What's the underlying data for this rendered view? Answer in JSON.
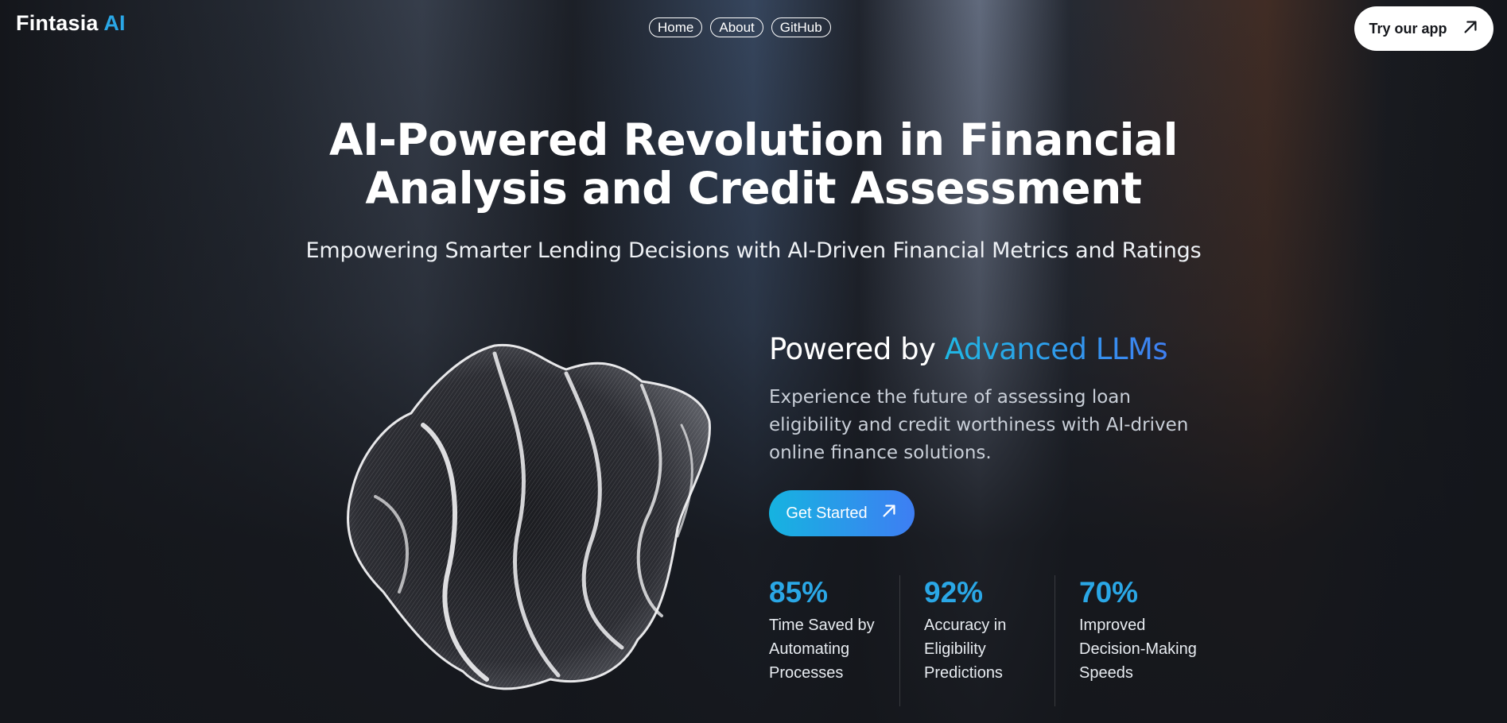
{
  "brand": {
    "name": "Fintasia",
    "accent": "AI",
    "accent_color": "#2aa7e6"
  },
  "nav": {
    "items": [
      {
        "label": "Home"
      },
      {
        "label": "About"
      },
      {
        "label": "GitHub"
      }
    ]
  },
  "header": {
    "cta_label": "Try our app",
    "cta_icon": "arrow-up-right-icon"
  },
  "hero": {
    "title_line1": "AI-Powered Revolution in Financial",
    "title_line2": "Analysis and Credit Assessment",
    "subtitle": "Empowering Smarter Lending Decisions with AI-Driven Financial Metrics and Ratings"
  },
  "feature": {
    "heading_prefix": "Powered by",
    "heading_highlight": "Advanced LLMs",
    "description": "Experience the future of assessing loan eligibility and credit worthiness with AI-driven online finance solutions.",
    "button_label": "Get Started",
    "button_icon": "arrow-up-right-icon"
  },
  "stats": [
    {
      "value": "85%",
      "label": "Time Saved by Automating Processes"
    },
    {
      "value": "92%",
      "label": "Accuracy in Eligibility Predictions"
    },
    {
      "value": "70%",
      "label": "Improved Decision-Making Speeds"
    }
  ],
  "colors": {
    "accent": "#2aa7e6",
    "gradient_start": "#16b3e0",
    "gradient_end": "#3e7ef3",
    "background": "#14161b"
  }
}
